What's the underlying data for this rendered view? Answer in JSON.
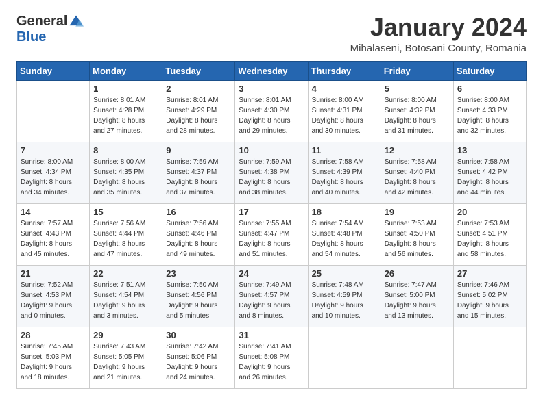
{
  "logo": {
    "general": "General",
    "blue": "Blue"
  },
  "title": "January 2024",
  "location": "Mihalaseni, Botosani County, Romania",
  "weekdays": [
    "Sunday",
    "Monday",
    "Tuesday",
    "Wednesday",
    "Thursday",
    "Friday",
    "Saturday"
  ],
  "weeks": [
    [
      {
        "day": "",
        "info": ""
      },
      {
        "day": "1",
        "info": "Sunrise: 8:01 AM\nSunset: 4:28 PM\nDaylight: 8 hours\nand 27 minutes."
      },
      {
        "day": "2",
        "info": "Sunrise: 8:01 AM\nSunset: 4:29 PM\nDaylight: 8 hours\nand 28 minutes."
      },
      {
        "day": "3",
        "info": "Sunrise: 8:01 AM\nSunset: 4:30 PM\nDaylight: 8 hours\nand 29 minutes."
      },
      {
        "day": "4",
        "info": "Sunrise: 8:00 AM\nSunset: 4:31 PM\nDaylight: 8 hours\nand 30 minutes."
      },
      {
        "day": "5",
        "info": "Sunrise: 8:00 AM\nSunset: 4:32 PM\nDaylight: 8 hours\nand 31 minutes."
      },
      {
        "day": "6",
        "info": "Sunrise: 8:00 AM\nSunset: 4:33 PM\nDaylight: 8 hours\nand 32 minutes."
      }
    ],
    [
      {
        "day": "7",
        "info": "Sunrise: 8:00 AM\nSunset: 4:34 PM\nDaylight: 8 hours\nand 34 minutes."
      },
      {
        "day": "8",
        "info": "Sunrise: 8:00 AM\nSunset: 4:35 PM\nDaylight: 8 hours\nand 35 minutes."
      },
      {
        "day": "9",
        "info": "Sunrise: 7:59 AM\nSunset: 4:37 PM\nDaylight: 8 hours\nand 37 minutes."
      },
      {
        "day": "10",
        "info": "Sunrise: 7:59 AM\nSunset: 4:38 PM\nDaylight: 8 hours\nand 38 minutes."
      },
      {
        "day": "11",
        "info": "Sunrise: 7:58 AM\nSunset: 4:39 PM\nDaylight: 8 hours\nand 40 minutes."
      },
      {
        "day": "12",
        "info": "Sunrise: 7:58 AM\nSunset: 4:40 PM\nDaylight: 8 hours\nand 42 minutes."
      },
      {
        "day": "13",
        "info": "Sunrise: 7:58 AM\nSunset: 4:42 PM\nDaylight: 8 hours\nand 44 minutes."
      }
    ],
    [
      {
        "day": "14",
        "info": "Sunrise: 7:57 AM\nSunset: 4:43 PM\nDaylight: 8 hours\nand 45 minutes."
      },
      {
        "day": "15",
        "info": "Sunrise: 7:56 AM\nSunset: 4:44 PM\nDaylight: 8 hours\nand 47 minutes."
      },
      {
        "day": "16",
        "info": "Sunrise: 7:56 AM\nSunset: 4:46 PM\nDaylight: 8 hours\nand 49 minutes."
      },
      {
        "day": "17",
        "info": "Sunrise: 7:55 AM\nSunset: 4:47 PM\nDaylight: 8 hours\nand 51 minutes."
      },
      {
        "day": "18",
        "info": "Sunrise: 7:54 AM\nSunset: 4:48 PM\nDaylight: 8 hours\nand 54 minutes."
      },
      {
        "day": "19",
        "info": "Sunrise: 7:53 AM\nSunset: 4:50 PM\nDaylight: 8 hours\nand 56 minutes."
      },
      {
        "day": "20",
        "info": "Sunrise: 7:53 AM\nSunset: 4:51 PM\nDaylight: 8 hours\nand 58 minutes."
      }
    ],
    [
      {
        "day": "21",
        "info": "Sunrise: 7:52 AM\nSunset: 4:53 PM\nDaylight: 9 hours\nand 0 minutes."
      },
      {
        "day": "22",
        "info": "Sunrise: 7:51 AM\nSunset: 4:54 PM\nDaylight: 9 hours\nand 3 minutes."
      },
      {
        "day": "23",
        "info": "Sunrise: 7:50 AM\nSunset: 4:56 PM\nDaylight: 9 hours\nand 5 minutes."
      },
      {
        "day": "24",
        "info": "Sunrise: 7:49 AM\nSunset: 4:57 PM\nDaylight: 9 hours\nand 8 minutes."
      },
      {
        "day": "25",
        "info": "Sunrise: 7:48 AM\nSunset: 4:59 PM\nDaylight: 9 hours\nand 10 minutes."
      },
      {
        "day": "26",
        "info": "Sunrise: 7:47 AM\nSunset: 5:00 PM\nDaylight: 9 hours\nand 13 minutes."
      },
      {
        "day": "27",
        "info": "Sunrise: 7:46 AM\nSunset: 5:02 PM\nDaylight: 9 hours\nand 15 minutes."
      }
    ],
    [
      {
        "day": "28",
        "info": "Sunrise: 7:45 AM\nSunset: 5:03 PM\nDaylight: 9 hours\nand 18 minutes."
      },
      {
        "day": "29",
        "info": "Sunrise: 7:43 AM\nSunset: 5:05 PM\nDaylight: 9 hours\nand 21 minutes."
      },
      {
        "day": "30",
        "info": "Sunrise: 7:42 AM\nSunset: 5:06 PM\nDaylight: 9 hours\nand 24 minutes."
      },
      {
        "day": "31",
        "info": "Sunrise: 7:41 AM\nSunset: 5:08 PM\nDaylight: 9 hours\nand 26 minutes."
      },
      {
        "day": "",
        "info": ""
      },
      {
        "day": "",
        "info": ""
      },
      {
        "day": "",
        "info": ""
      }
    ]
  ]
}
